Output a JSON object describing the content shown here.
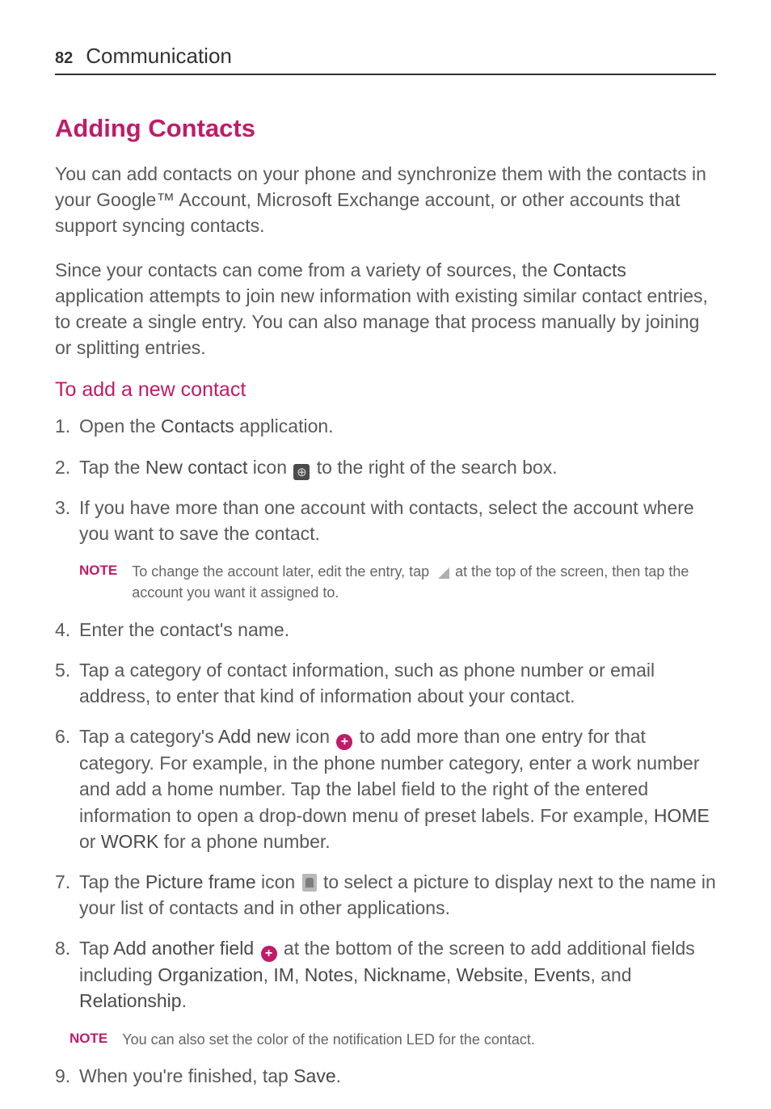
{
  "header": {
    "page_number": "82",
    "title": "Communication"
  },
  "section": {
    "heading": "Adding Contacts",
    "para1": "You can add contacts on your phone and synchronize them with the contacts in your Google™ Account, Microsoft Exchange account, or other accounts that support syncing contacts.",
    "para2a": "Since your contacts can come from a variety of sources, the ",
    "para2b_bold": "Contacts",
    "para2c": " application attempts to join new information with existing similar contact entries, to create a single entry. You can also manage that process manually by joining or splitting entries."
  },
  "subhead": "To add a new contact",
  "steps": {
    "s1a": "Open the ",
    "s1b_bold": "Contacts",
    "s1c": " application.",
    "s2a": "Tap the ",
    "s2b_bold": "New contact",
    "s2c": " icon ",
    "s2d": " to the right of the search box.",
    "s3": "If you have more than one account with contacts, select the account where you want to save the contact.",
    "note1_label": "NOTE",
    "note1a": "To change the account later, edit the entry, tap ",
    "note1b": " at the top of the screen, then tap the account you want it assigned to.",
    "s4": "Enter the contact's name.",
    "s5": "Tap a category of contact information, such as phone number or email address, to enter that kind of information about your contact.",
    "s6a": "Tap a category's ",
    "s6b_bold": "Add new",
    "s6c": " icon ",
    "s6d": " to add more than one entry for that category. For example, in the phone number category, enter a work number and add a home number. Tap the label field to the right of the entered information to open a drop-down menu of preset labels. For example, ",
    "s6e_bold": "HOME",
    "s6f": " or ",
    "s6g_bold": "WORK",
    "s6h": " for a phone number.",
    "s7a": "Tap the ",
    "s7b_bold": "Picture frame",
    "s7c": " icon ",
    "s7d": " to select a picture to display next to the name in your list of contacts and in other applications.",
    "s8a": "Tap ",
    "s8b_bold": "Add another field",
    "s8c": " ",
    "s8d": " at the bottom of the screen to add additional fields including ",
    "s8e_bold": "Organization",
    "s8f": ", ",
    "s8g_bold": "IM",
    "s8h": ", ",
    "s8i_bold": "Notes",
    "s8j": ", ",
    "s8k_bold": "Nickname",
    "s8l": ", ",
    "s8m_bold": "Website",
    "s8n": ", ",
    "s8o_bold": "Events",
    "s8p": ", and ",
    "s8q_bold": "Relationship",
    "s8r": ".",
    "note2_label": "NOTE",
    "note2": "You can also set the color of the notification LED for the contact.",
    "s9a": "When you're finished, tap ",
    "s9b_bold": "Save",
    "s9c": "."
  }
}
